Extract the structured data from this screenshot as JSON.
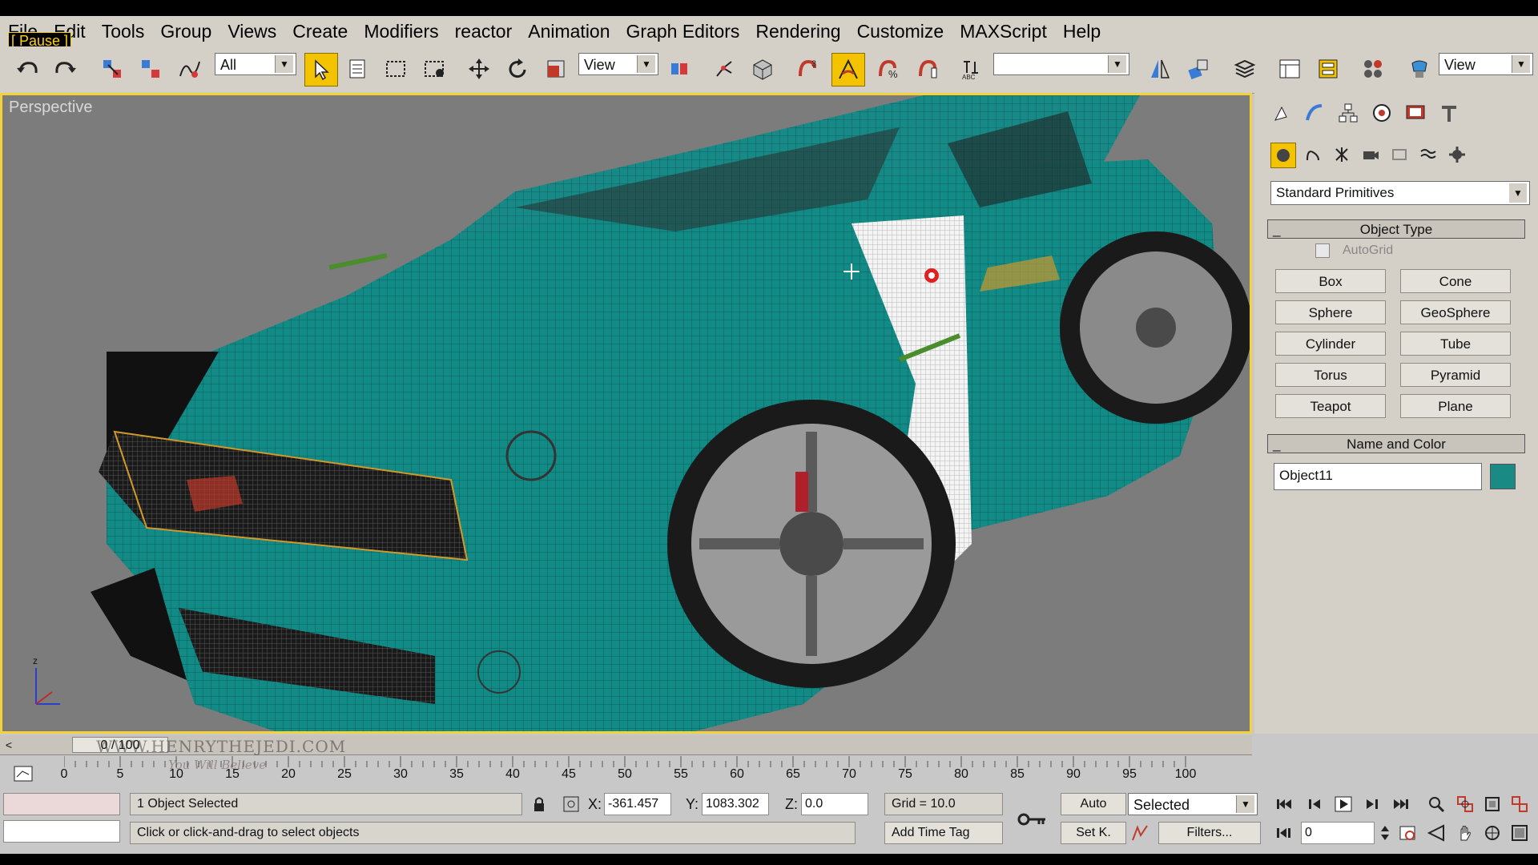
{
  "overlay": {
    "pause_label": "[ Pause ]"
  },
  "menu": [
    "File",
    "Edit",
    "Tools",
    "Group",
    "Views",
    "Create",
    "Modifiers",
    "reactor",
    "Animation",
    "Graph Editors",
    "Rendering",
    "Customize",
    "MAXScript",
    "Help"
  ],
  "toolbar": {
    "selection_filter": "All",
    "ref_coord": "View",
    "named_selection": "",
    "render_view": "View"
  },
  "viewport": {
    "label": "Perspective"
  },
  "command_panel": {
    "category": "Standard Primitives",
    "object_type_title": "Object Type",
    "autogrid_label": "AutoGrid",
    "objects": [
      "Box",
      "Cone",
      "Sphere",
      "GeoSphere",
      "Cylinder",
      "Tube",
      "Torus",
      "Pyramid",
      "Teapot",
      "Plane"
    ],
    "name_color_title": "Name and Color",
    "object_name": "Object11",
    "object_color": "#1a8a85"
  },
  "timeline": {
    "slider_label": "0 / 100",
    "ticks": [
      "0",
      "5",
      "10",
      "15",
      "20",
      "25",
      "30",
      "35",
      "40",
      "45",
      "50",
      "55",
      "60",
      "65",
      "70",
      "75",
      "80",
      "85",
      "90",
      "95",
      "100"
    ]
  },
  "watermark": {
    "text": "WWW.HENRYTHEJEDI.COM",
    "subtext": "You Will Believe"
  },
  "status": {
    "selection": "1 Object Selected",
    "prompt": "Click or click-and-drag to select objects",
    "x_label": "X:",
    "x_value": "-361.457",
    "y_label": "Y:",
    "y_value": "1083.302",
    "z_label": "Z:",
    "z_value": "0.0",
    "grid": "Grid = 10.0",
    "add_time_tag": "Add Time Tag",
    "auto_key": "Auto",
    "set_key": "Set K.",
    "key_filter": "Selected",
    "filters": "Filters...",
    "frame": "0"
  }
}
